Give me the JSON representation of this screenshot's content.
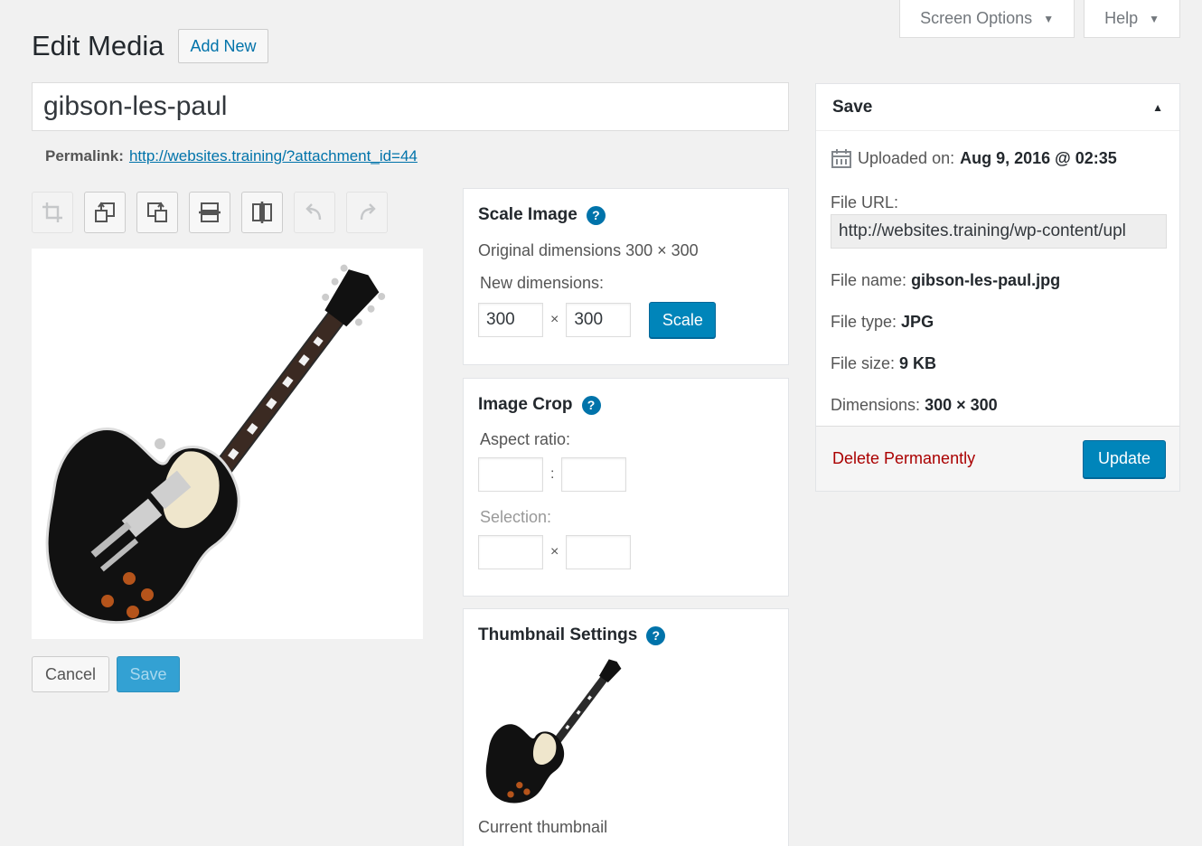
{
  "header": {
    "title": "Edit Media",
    "add_new": "Add New",
    "screen_options": "Screen Options",
    "help": "Help"
  },
  "media": {
    "title_value": "gibson-les-paul",
    "permalink_label": "Permalink:",
    "permalink_url": "http://websites.training/?attachment_id=44"
  },
  "toolbar": {
    "icons": [
      "crop-icon",
      "rotate-left-icon",
      "rotate-right-icon",
      "flip-vertical-icon",
      "flip-horizontal-icon",
      "undo-icon",
      "redo-icon"
    ]
  },
  "edit_actions": {
    "cancel": "Cancel",
    "save": "Save"
  },
  "scale_image": {
    "title": "Scale Image",
    "original": "Original dimensions 300 × 300",
    "new_label": "New dimensions:",
    "width": "300",
    "height": "300",
    "separator": "×",
    "button": "Scale"
  },
  "image_crop": {
    "title": "Image Crop",
    "aspect_label": "Aspect ratio:",
    "aspect_sep": ":",
    "selection_label": "Selection:",
    "selection_sep": "×"
  },
  "thumbnail": {
    "title": "Thumbnail Settings",
    "current": "Current thumbnail"
  },
  "save_box": {
    "title": "Save",
    "uploaded_label": "Uploaded on:",
    "uploaded_value": "Aug 9, 2016 @ 02:35",
    "file_url_label": "File URL:",
    "file_url_value": "http://websites.training/wp-content/upl",
    "file_name_label": "File name:",
    "file_name_value": "gibson-les-paul.jpg",
    "file_type_label": "File type:",
    "file_type_value": "JPG",
    "file_size_label": "File size:",
    "file_size_value": "9 KB",
    "dimensions_label": "Dimensions:",
    "dimensions_value": "300 × 300",
    "delete": "Delete Permanently",
    "update": "Update"
  },
  "help_glyph": "?",
  "colors": {
    "primary": "#0085ba",
    "link": "#0073aa",
    "delete": "#aa0000",
    "background": "#f1f1f1"
  }
}
